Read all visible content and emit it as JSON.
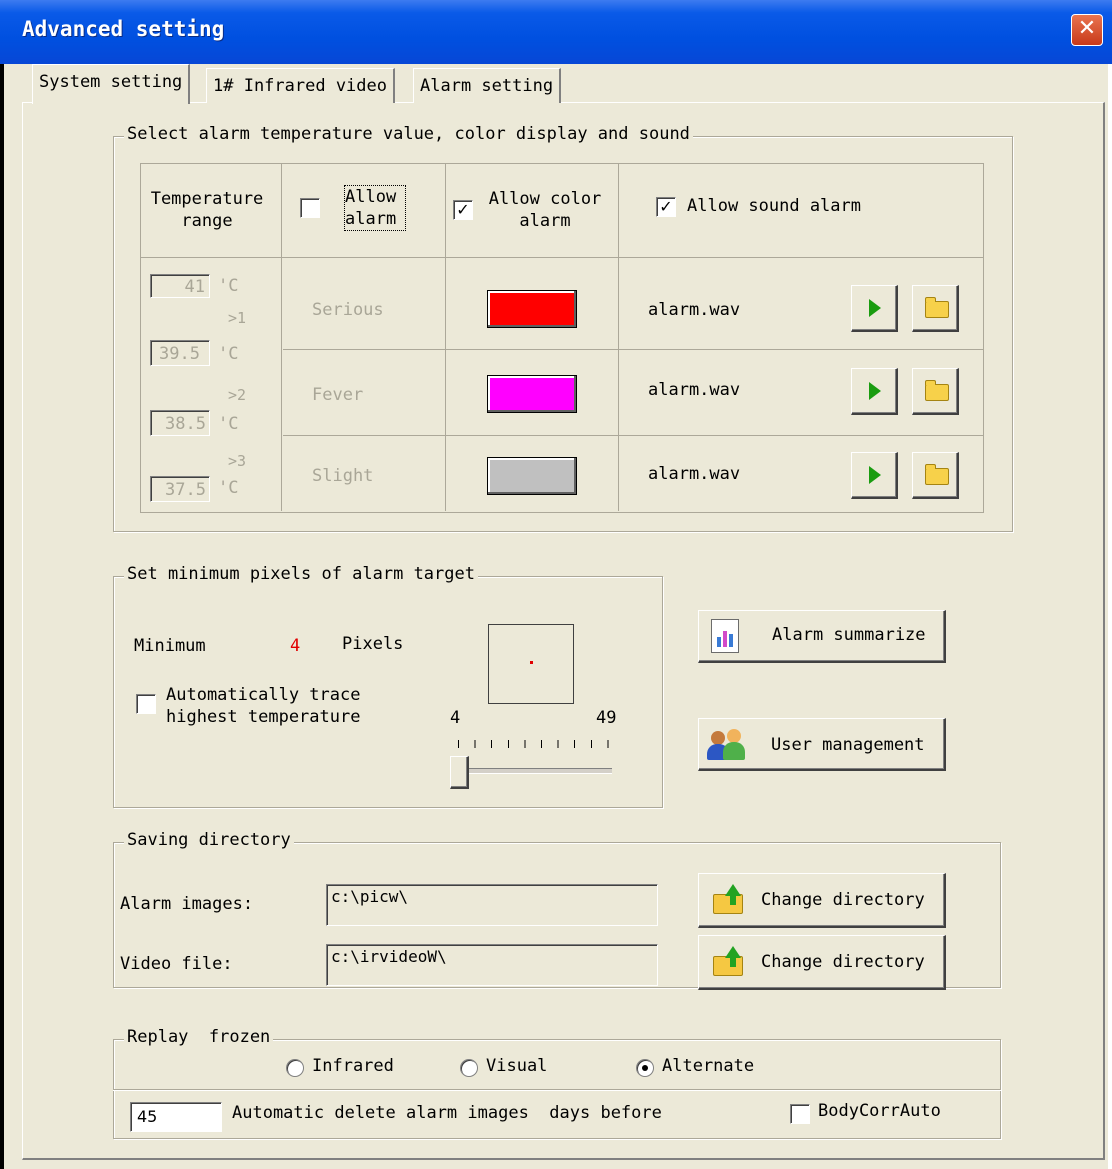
{
  "window": {
    "title": "Advanced setting",
    "close_glyph": "✕"
  },
  "tabs": [
    {
      "label": "System setting",
      "active": true
    },
    {
      "label": "1# Infrared video",
      "active": false
    },
    {
      "label": "Alarm setting",
      "active": false
    }
  ],
  "alarm_group": {
    "label": "Select alarm temperature value, color display and sound",
    "header": {
      "temp_range": "Temperature range",
      "allow_alarm": "Allow alarm",
      "allow_alarm_checked": false,
      "allow_color": "Allow color alarm",
      "allow_color_checked": true,
      "allow_sound": "Allow sound alarm",
      "allow_sound_checked": true
    },
    "thresholds": [
      "41",
      "39.5",
      "38.5",
      "37.5"
    ],
    "unit": "'C",
    "level_marks": [
      ">1",
      ">2",
      ">3"
    ],
    "levels": [
      {
        "name": "Serious",
        "color": "#FF0000",
        "sound": "alarm.wav"
      },
      {
        "name": "Fever",
        "color": "#FF00FF",
        "sound": "alarm.wav"
      },
      {
        "name": "Slight",
        "color": "#C0C0C0",
        "sound": "alarm.wav"
      }
    ]
  },
  "pixels_group": {
    "label": "Set minimum pixels of alarm target",
    "minimum_label": "Minimum",
    "minimum_value": "4",
    "pixels_label": "Pixels",
    "auto_trace_label": "Automatically trace highest temperature",
    "auto_trace_checked": false,
    "slider_min": "4",
    "slider_max": "49",
    "slider_value": 4
  },
  "side_buttons": {
    "alarm_summarize": "Alarm summarize",
    "user_management": "User management"
  },
  "saving_group": {
    "label": "Saving directory",
    "alarm_images_label": "Alarm images:",
    "alarm_images_path": "c:\\picw\\",
    "video_file_label": "Video file:",
    "video_file_path": "c:\\irvideoW\\",
    "change_directory": "Change directory"
  },
  "replay_group": {
    "label": "Replay  frozen",
    "options": [
      {
        "label": "Infrared",
        "selected": false
      },
      {
        "label": "Visual",
        "selected": false
      },
      {
        "label": "Alternate",
        "selected": true
      }
    ],
    "days_value": "45",
    "delete_label": "Automatic delete alarm images  days before",
    "bodycorr_label": "BodyCorrAuto",
    "bodycorr_checked": false
  },
  "colors": {
    "titlebar": "#0050E0",
    "face": "#ECE9D8",
    "minimum_value": "#E00000"
  }
}
